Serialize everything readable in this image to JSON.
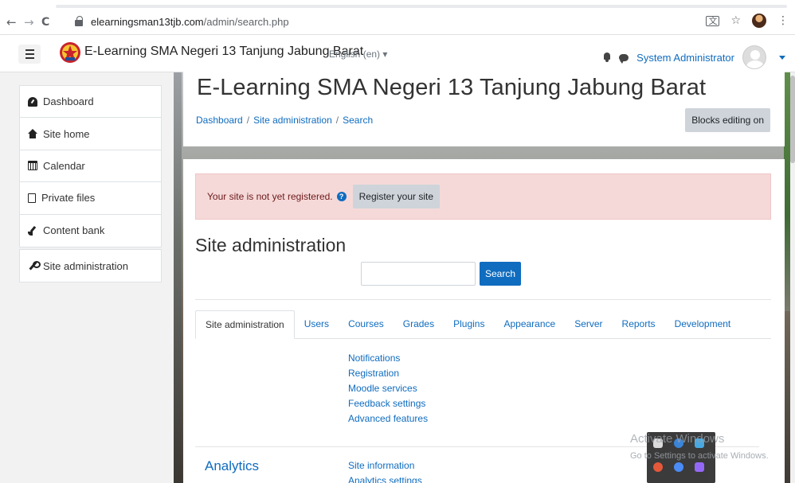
{
  "browser": {
    "back": "←",
    "forward": "→",
    "reload": "C",
    "url_host": "elearningsman13tjb.com",
    "url_path": "/admin/search.php",
    "translate_icon": "translate-icon",
    "star": "☆",
    "menu": "⋮"
  },
  "navbar": {
    "site_name": "E-Learning SMA Negeri 13 Tanjung Jabung Barat",
    "language": "English (en) ▾",
    "user_name": "System Administrator",
    "icons": [
      "hamburger-icon",
      "logo-icon",
      "bell-icon",
      "chat-icon",
      "avatar",
      "caret-icon"
    ]
  },
  "drawer": {
    "items": [
      {
        "label": "Dashboard",
        "icon": "dashboard-icon"
      },
      {
        "label": "Site home",
        "icon": "home-icon"
      },
      {
        "label": "Calendar",
        "icon": "calendar-icon"
      },
      {
        "label": "Private files",
        "icon": "file-icon"
      },
      {
        "label": "Content bank",
        "icon": "brush-icon"
      }
    ],
    "admin_item": {
      "label": "Site administration",
      "icon": "wrench-icon"
    }
  },
  "header": {
    "title": "E-Learning SMA Negeri 13 Tanjung Jabung Barat",
    "breadcrumb": [
      "Dashboard",
      "Site administration",
      "Search"
    ],
    "separator": "/",
    "blocks_editing": "Blocks editing on"
  },
  "main": {
    "alert_text": "Your site is not yet registered.",
    "help": "?",
    "register_button": "Register your site",
    "section_title": "Site administration",
    "search_button": "Search",
    "search_value": "",
    "tabs": [
      "Site administration",
      "Users",
      "Courses",
      "Grades",
      "Plugins",
      "Appearance",
      "Server",
      "Reports",
      "Development"
    ],
    "general_links": [
      "Notifications",
      "Registration",
      "Moodle services",
      "Feedback settings",
      "Advanced features"
    ],
    "analytics_title": "Analytics",
    "analytics_links": [
      "Site information",
      "Analytics settings"
    ]
  },
  "overlay": {
    "activate": "Activate Windows",
    "activate_sub": "Go to Settings to activate Windows."
  },
  "colors": {
    "link": "#0f6cbf",
    "alert_bg": "#f5d9d9",
    "button_gray": "#ced4da",
    "drawer_bg": "#f2f2f2"
  }
}
